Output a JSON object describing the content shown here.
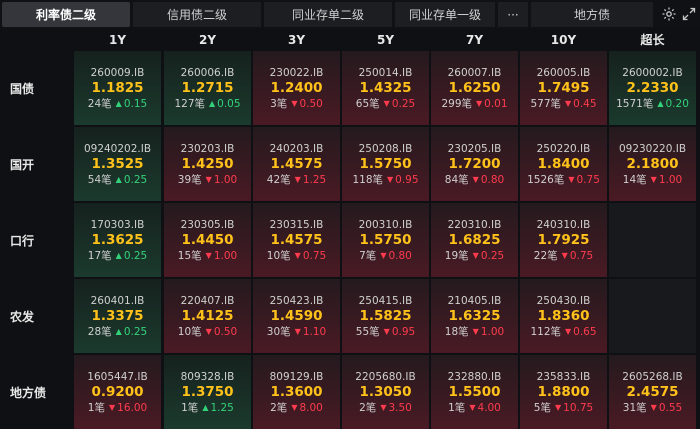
{
  "tabs": [
    {
      "label": "利率债二级",
      "active": true
    },
    {
      "label": "信用债二级",
      "active": false
    },
    {
      "label": "同业存单二级",
      "active": false
    },
    {
      "label": "同业存单一级",
      "active": false
    },
    {
      "label": "地方债",
      "active": false
    }
  ],
  "more_label": "···",
  "icons": {
    "settings": "gear-icon",
    "expand": "expand-icon"
  },
  "colors": {
    "up": "#33d27a",
    "down": "#ff3b4d",
    "yield": "#ffc21a"
  },
  "columns": [
    "1Y",
    "2Y",
    "3Y",
    "5Y",
    "7Y",
    "10Y",
    "超长"
  ],
  "rows": [
    {
      "label": "国债",
      "cells": [
        {
          "code": "260009.IB",
          "yield": "1.1825",
          "count": "24笔",
          "dir": "up",
          "change": "0.15"
        },
        {
          "code": "260006.IB",
          "yield": "1.2715",
          "count": "127笔",
          "dir": "up",
          "change": "0.05"
        },
        {
          "code": "230022.IB",
          "yield": "1.2400",
          "count": "3笔",
          "dir": "down",
          "change": "0.50"
        },
        {
          "code": "250014.IB",
          "yield": "1.4325",
          "count": "65笔",
          "dir": "down",
          "change": "0.25"
        },
        {
          "code": "260007.IB",
          "yield": "1.6250",
          "count": "299笔",
          "dir": "down",
          "change": "0.01"
        },
        {
          "code": "260005.IB",
          "yield": "1.7495",
          "count": "577笔",
          "dir": "down",
          "change": "0.45"
        },
        {
          "code": "2600002.IB",
          "yield": "2.2330",
          "count": "1571笔",
          "dir": "up",
          "change": "0.20"
        }
      ]
    },
    {
      "label": "国开",
      "cells": [
        {
          "code": "09240202.IB",
          "yield": "1.3525",
          "count": "54笔",
          "dir": "up",
          "change": "0.25"
        },
        {
          "code": "230203.IB",
          "yield": "1.4250",
          "count": "39笔",
          "dir": "down",
          "change": "1.00"
        },
        {
          "code": "240203.IB",
          "yield": "1.4575",
          "count": "42笔",
          "dir": "down",
          "change": "1.25"
        },
        {
          "code": "250208.IB",
          "yield": "1.5750",
          "count": "118笔",
          "dir": "down",
          "change": "0.95"
        },
        {
          "code": "230205.IB",
          "yield": "1.7200",
          "count": "84笔",
          "dir": "down",
          "change": "0.80"
        },
        {
          "code": "250220.IB",
          "yield": "1.8400",
          "count": "1526笔",
          "dir": "down",
          "change": "0.75"
        },
        {
          "code": "09230220.IB",
          "yield": "2.1800",
          "count": "14笔",
          "dir": "down",
          "change": "1.00"
        }
      ]
    },
    {
      "label": "口行",
      "cells": [
        {
          "code": "170303.IB",
          "yield": "1.3625",
          "count": "17笔",
          "dir": "up",
          "change": "0.25"
        },
        {
          "code": "230305.IB",
          "yield": "1.4450",
          "count": "15笔",
          "dir": "down",
          "change": "1.00"
        },
        {
          "code": "230315.IB",
          "yield": "1.4575",
          "count": "10笔",
          "dir": "down",
          "change": "0.75"
        },
        {
          "code": "200310.IB",
          "yield": "1.5750",
          "count": "7笔",
          "dir": "down",
          "change": "0.80"
        },
        {
          "code": "220310.IB",
          "yield": "1.6825",
          "count": "19笔",
          "dir": "down",
          "change": "0.25"
        },
        {
          "code": "240310.IB",
          "yield": "1.7925",
          "count": "22笔",
          "dir": "down",
          "change": "0.75"
        },
        null
      ]
    },
    {
      "label": "农发",
      "cells": [
        {
          "code": "260401.IB",
          "yield": "1.3375",
          "count": "28笔",
          "dir": "up",
          "change": "0.25"
        },
        {
          "code": "220407.IB",
          "yield": "1.4125",
          "count": "10笔",
          "dir": "down",
          "change": "0.50"
        },
        {
          "code": "250423.IB",
          "yield": "1.4590",
          "count": "30笔",
          "dir": "down",
          "change": "1.10"
        },
        {
          "code": "250415.IB",
          "yield": "1.5825",
          "count": "55笔",
          "dir": "down",
          "change": "0.95"
        },
        {
          "code": "210405.IB",
          "yield": "1.6325",
          "count": "18笔",
          "dir": "down",
          "change": "1.00"
        },
        {
          "code": "250430.IB",
          "yield": "1.8360",
          "count": "112笔",
          "dir": "down",
          "change": "0.65"
        },
        null
      ]
    },
    {
      "label": "地方债",
      "cells": [
        {
          "code": "1605447.IB",
          "yield": "0.9200",
          "count": "1笔",
          "dir": "down",
          "change": "16.00"
        },
        {
          "code": "809328.IB",
          "yield": "1.3750",
          "count": "1笔",
          "dir": "up",
          "change": "1.25"
        },
        {
          "code": "809129.IB",
          "yield": "1.3600",
          "count": "2笔",
          "dir": "down",
          "change": "8.00"
        },
        {
          "code": "2205680.IB",
          "yield": "1.3050",
          "count": "2笔",
          "dir": "down",
          "change": "3.50"
        },
        {
          "code": "232880.IB",
          "yield": "1.5500",
          "count": "1笔",
          "dir": "down",
          "change": "4.00"
        },
        {
          "code": "235833.IB",
          "yield": "1.8800",
          "count": "5笔",
          "dir": "down",
          "change": "10.75"
        },
        {
          "code": "2605268.IB",
          "yield": "2.4575",
          "count": "31笔",
          "dir": "down",
          "change": "0.55"
        }
      ]
    }
  ]
}
